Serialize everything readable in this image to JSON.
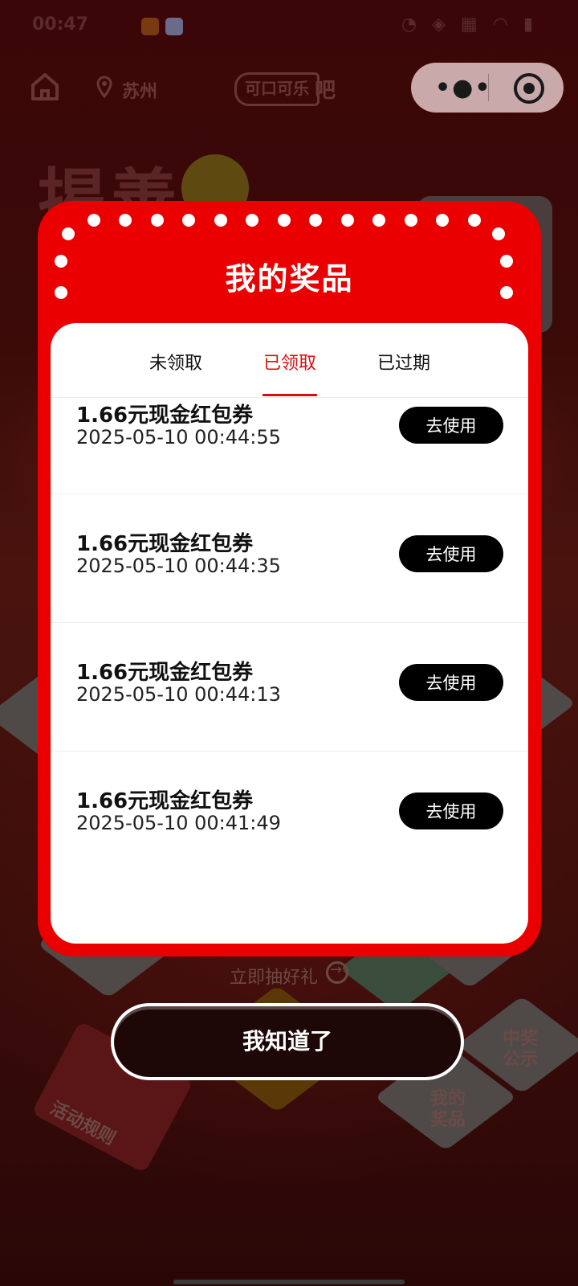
{
  "status_bar": {
    "time": "00:47"
  },
  "top_bar": {
    "city": "苏州",
    "brand": "可口可乐",
    "brand_suffix": "吧"
  },
  "background": {
    "headline": "揭善",
    "lucky_draw_link": "立即抽好礼",
    "tiles": {
      "rules": "活动规则",
      "my_prizes": "我的奖品",
      "winners": "中奖公示"
    }
  },
  "modal": {
    "title": "我的奖品",
    "tabs": [
      {
        "label": "未领取"
      },
      {
        "label": "已领取"
      },
      {
        "label": "已过期"
      }
    ],
    "active_tab": "已领取",
    "prizes": [
      {
        "name": "1.66元现金红包券",
        "date": "2025-05-10 00:44:55",
        "action": "去使用"
      },
      {
        "name": "1.66元现金红包券",
        "date": "2025-05-10 00:44:35",
        "action": "去使用"
      },
      {
        "name": "1.66元现金红包券",
        "date": "2025-05-10 00:44:13",
        "action": "去使用"
      },
      {
        "name": "1.66元现金红包券",
        "date": "2025-05-10 00:41:49",
        "action": "去使用"
      }
    ]
  },
  "confirm_button": "我知道了",
  "colors": {
    "modal_red": "#ea0000",
    "active_tab": "#d80f0f",
    "button_black": "#000000"
  }
}
